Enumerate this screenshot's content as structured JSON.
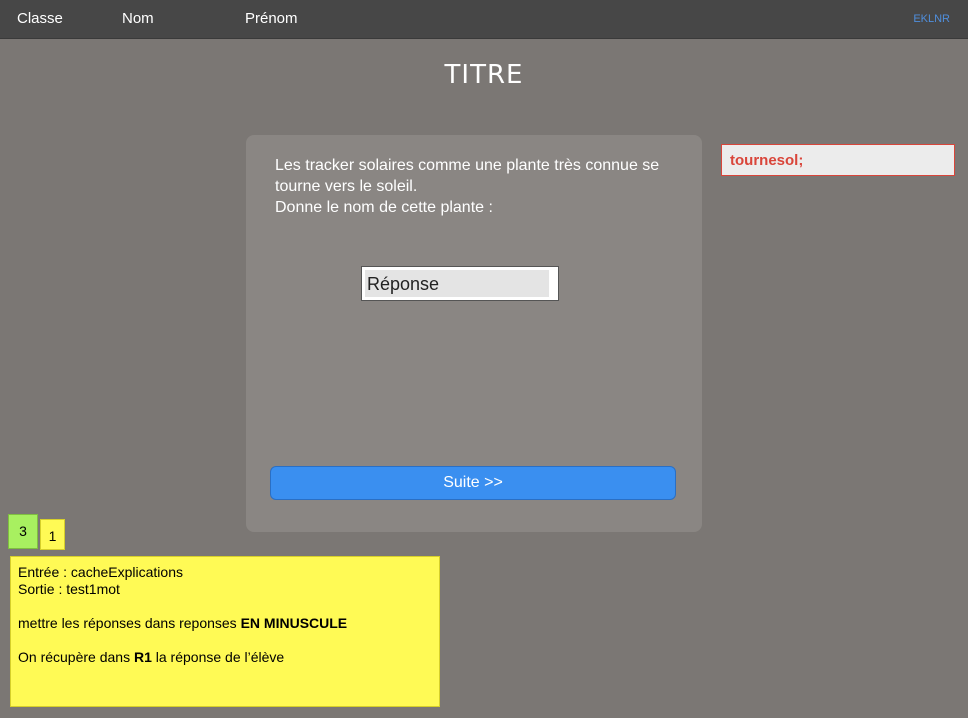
{
  "header": {
    "classe_label": "Classe",
    "nom_label": "Nom",
    "prenom_label": "Prénom",
    "code": "EKLNR"
  },
  "title": "TITRE",
  "question": {
    "text": "Les tracker solaires comme une plante très connue  se tourne vers le soleil.\nDonne le nom de cette plante :"
  },
  "answer": {
    "placeholder": "Réponse",
    "value": ""
  },
  "next_button": {
    "label": "Suite >>"
  },
  "expected_answer": "tournesol;",
  "badges": {
    "green": "3",
    "yellow": "1"
  },
  "notes": {
    "line1": "Entrée : cacheExplications",
    "line2": "Sortie : test1mot",
    "line3_prefix": "mettre les réponses dans reponses  ",
    "line3_bold": "EN MINUSCULE",
    "line4_prefix": "On récupère dans ",
    "line4_bold": "R1",
    "line4_suffix": " la réponse de l’élève"
  },
  "colors": {
    "background": "#7b7774",
    "topbar": "#474747",
    "card": "#8a8683",
    "button": "#3a8ff0",
    "expected_text": "#d9453a",
    "note_yellow": "#fffa55",
    "badge_green": "#a8f060"
  }
}
